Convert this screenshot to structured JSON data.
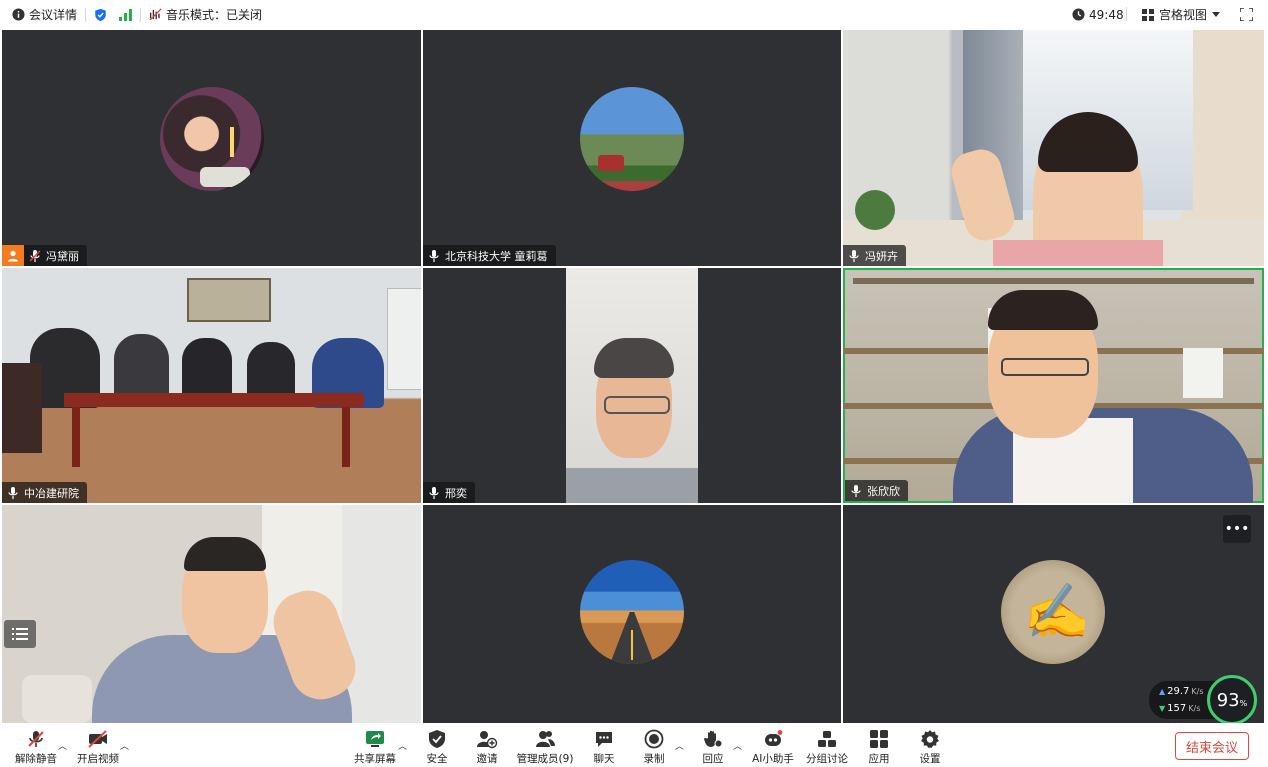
{
  "topbar": {
    "meeting_info": "会议详情",
    "music_mode": "音乐模式：已关闭",
    "timer": "49:48",
    "view_mode": "宫格视图"
  },
  "participants": [
    {
      "name": "冯黛丽",
      "type": "avatar",
      "host": true
    },
    {
      "name": "北京科技大学 童莉葛",
      "type": "avatar"
    },
    {
      "name": "冯妍卉",
      "type": "video"
    },
    {
      "name": "中冶建研院",
      "type": "video"
    },
    {
      "name": "邢奕",
      "type": "video"
    },
    {
      "name": "张欣欣",
      "type": "video",
      "active_speaker": true
    },
    {
      "name": "",
      "type": "video"
    },
    {
      "name": "",
      "type": "avatar"
    },
    {
      "name": "",
      "type": "avatar"
    }
  ],
  "network": {
    "up": "29.7",
    "down": "157",
    "unit": "K/s",
    "quality": "93",
    "quality_unit": "%"
  },
  "toolbar": {
    "unmute": "解除静音",
    "start_video": "开启视频",
    "share_screen": "共享屏幕",
    "security": "安全",
    "invite": "邀请",
    "manage_members": "管理成员(9)",
    "chat": "聊天",
    "record": "录制",
    "react": "回应",
    "ai_assistant": "AI小助手",
    "breakout": "分组讨论",
    "apps": "应用",
    "settings": "设置",
    "end_meeting": "结束会议"
  },
  "colors": {
    "accent": "#1a6ef5",
    "active_border": "#22b14c",
    "end": "#e0463b",
    "tile_bg": "#2e3033"
  }
}
